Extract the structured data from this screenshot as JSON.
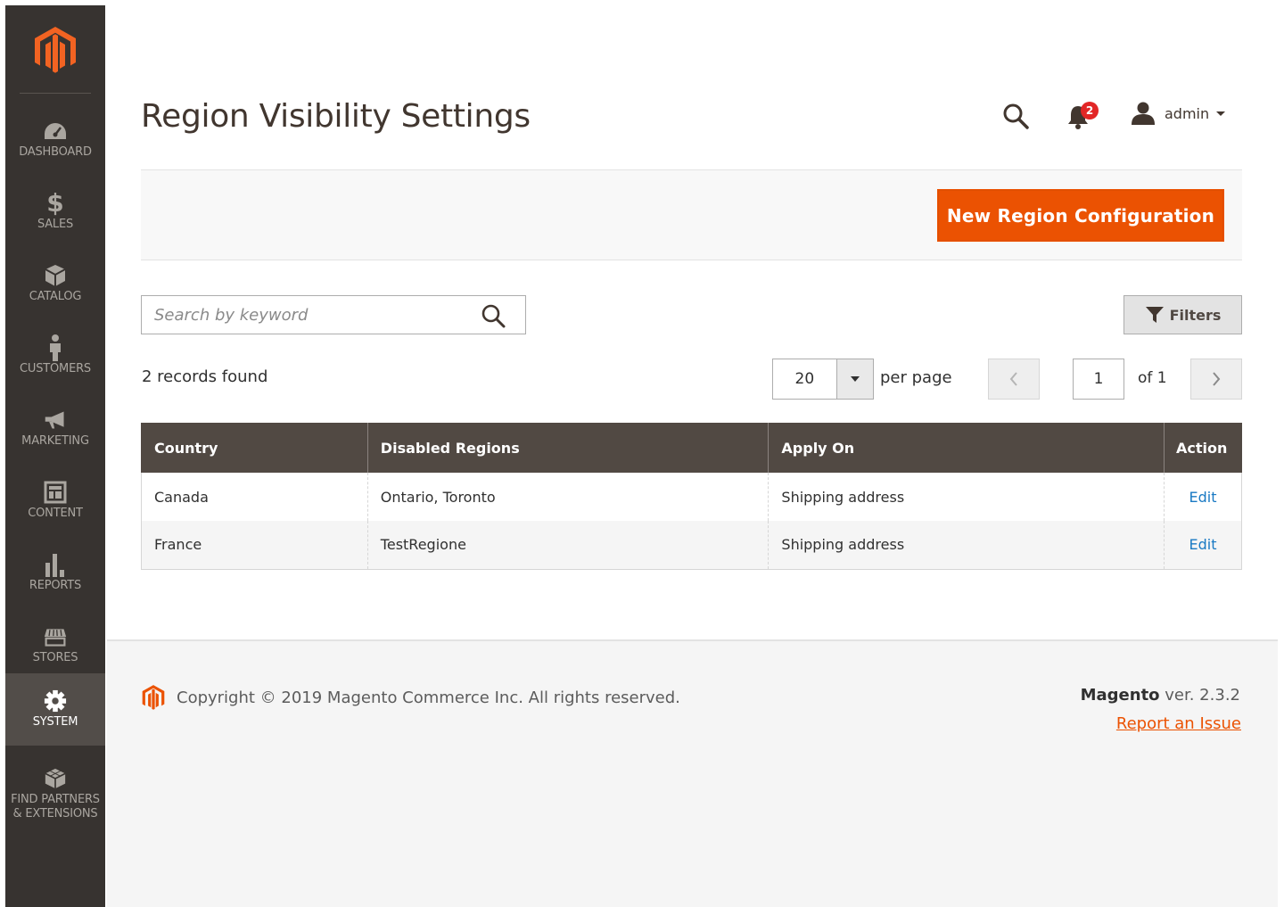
{
  "colors": {
    "sidebar_bg": "#373330",
    "sidebar_active": "#524d49",
    "accent": "#eb5202",
    "table_header": "#514943",
    "link": "#1979c3",
    "badge": "#e22626"
  },
  "sidebar": {
    "logo_icon": "magento-logo-icon",
    "items": [
      {
        "label": "DASHBOARD",
        "icon": "gauge-icon",
        "active": false
      },
      {
        "label": "SALES",
        "icon": "dollar-icon",
        "active": false
      },
      {
        "label": "CATALOG",
        "icon": "box-icon",
        "active": false
      },
      {
        "label": "CUSTOMERS",
        "icon": "person-icon",
        "active": false
      },
      {
        "label": "MARKETING",
        "icon": "megaphone-icon",
        "active": false
      },
      {
        "label": "CONTENT",
        "icon": "layout-icon",
        "active": false
      },
      {
        "label": "REPORTS",
        "icon": "bar-chart-icon",
        "active": false
      },
      {
        "label": "STORES",
        "icon": "storefront-icon",
        "active": false
      },
      {
        "label": "SYSTEM",
        "icon": "gear-icon",
        "active": true
      },
      {
        "label": "FIND PARTNERS & EXTENSIONS",
        "icon": "blocks-icon",
        "active": false
      }
    ]
  },
  "header": {
    "title": "Region Visibility Settings",
    "notifications_count": "2",
    "user": "admin"
  },
  "actions": {
    "primary_label": "New Region Configuration"
  },
  "search": {
    "placeholder": "Search by keyword",
    "value": ""
  },
  "toolbar": {
    "filters_label": "Filters",
    "records_found": "2 records found",
    "per_page_value": "20",
    "per_page_label": "per page",
    "page_current": "1",
    "page_total_label": "of 1"
  },
  "table": {
    "columns": [
      "Country",
      "Disabled Regions",
      "Apply On",
      "Action"
    ],
    "rows": [
      {
        "country": "Canada",
        "regions": "Ontario, Toronto",
        "apply_on": "Shipping address",
        "action": "Edit"
      },
      {
        "country": "France",
        "regions": "TestRegione",
        "apply_on": "Shipping address",
        "action": "Edit"
      }
    ]
  },
  "footer": {
    "copyright": "Copyright © 2019 Magento Commerce Inc. All rights reserved.",
    "brand": "Magento",
    "version": " ver. 2.3.2",
    "report_link": "Report an Issue"
  }
}
